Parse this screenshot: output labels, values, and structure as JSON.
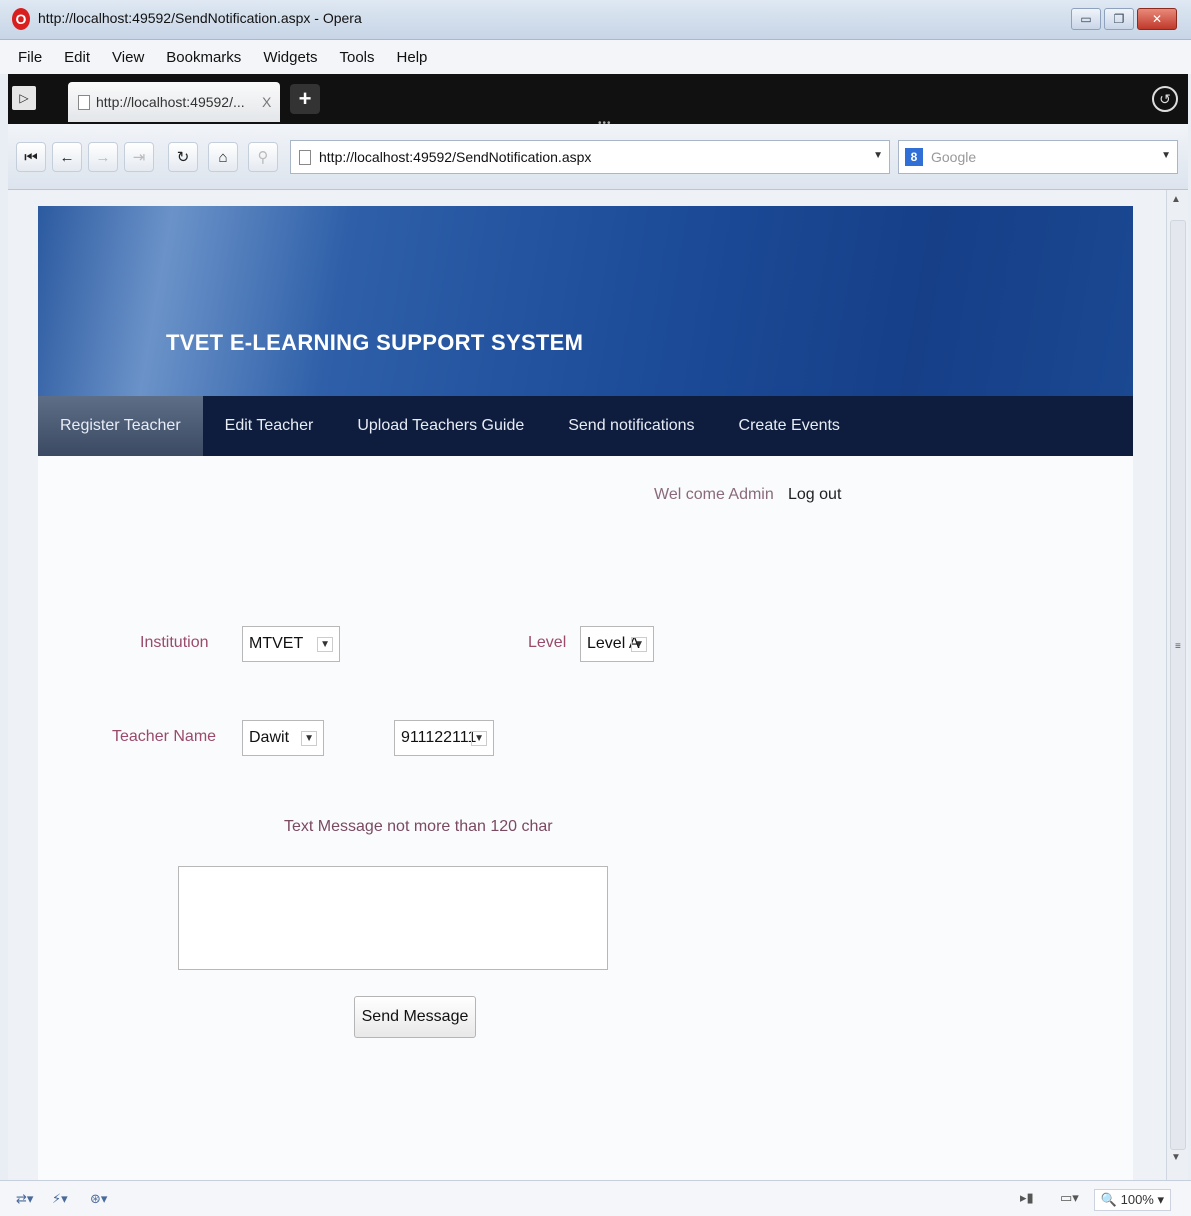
{
  "window": {
    "title": "http://localhost:49592/SendNotification.aspx - Opera",
    "minimize": "▭",
    "maximize": "❐",
    "close": "✕"
  },
  "menu": [
    "File",
    "Edit",
    "View",
    "Bookmarks",
    "Widgets",
    "Tools",
    "Help"
  ],
  "tab": {
    "label": "http://localhost:49592/...",
    "close": "X",
    "new_tab": "+"
  },
  "toolbar": {
    "address": "http://localhost:49592/SendNotification.aspx",
    "search_placeholder": "Google",
    "search_engine_icon": "8"
  },
  "site": {
    "title": "TVET E-LEARNING SUPPORT SYSTEM",
    "nav": [
      "Register Teacher",
      "Edit Teacher",
      "Upload Teachers Guide",
      "Send notifications",
      "Create Events"
    ],
    "welcome": "Wel come Admin",
    "logout": "Log out"
  },
  "form": {
    "institution_label": "Institution",
    "institution_value": "MTVET",
    "level_label": "Level",
    "level_value": "Level A",
    "teacher_label": "Teacher Name",
    "teacher_value": "Dawit",
    "phone_value": "911122111",
    "message_hint": "Text Message not more than 120 char",
    "send_label": "Send Message"
  },
  "status": {
    "zoom": "100%"
  },
  "colors": {
    "banner": "#1d4c99",
    "navbar": "#0e1d3d",
    "label": "#9a4a6a"
  }
}
